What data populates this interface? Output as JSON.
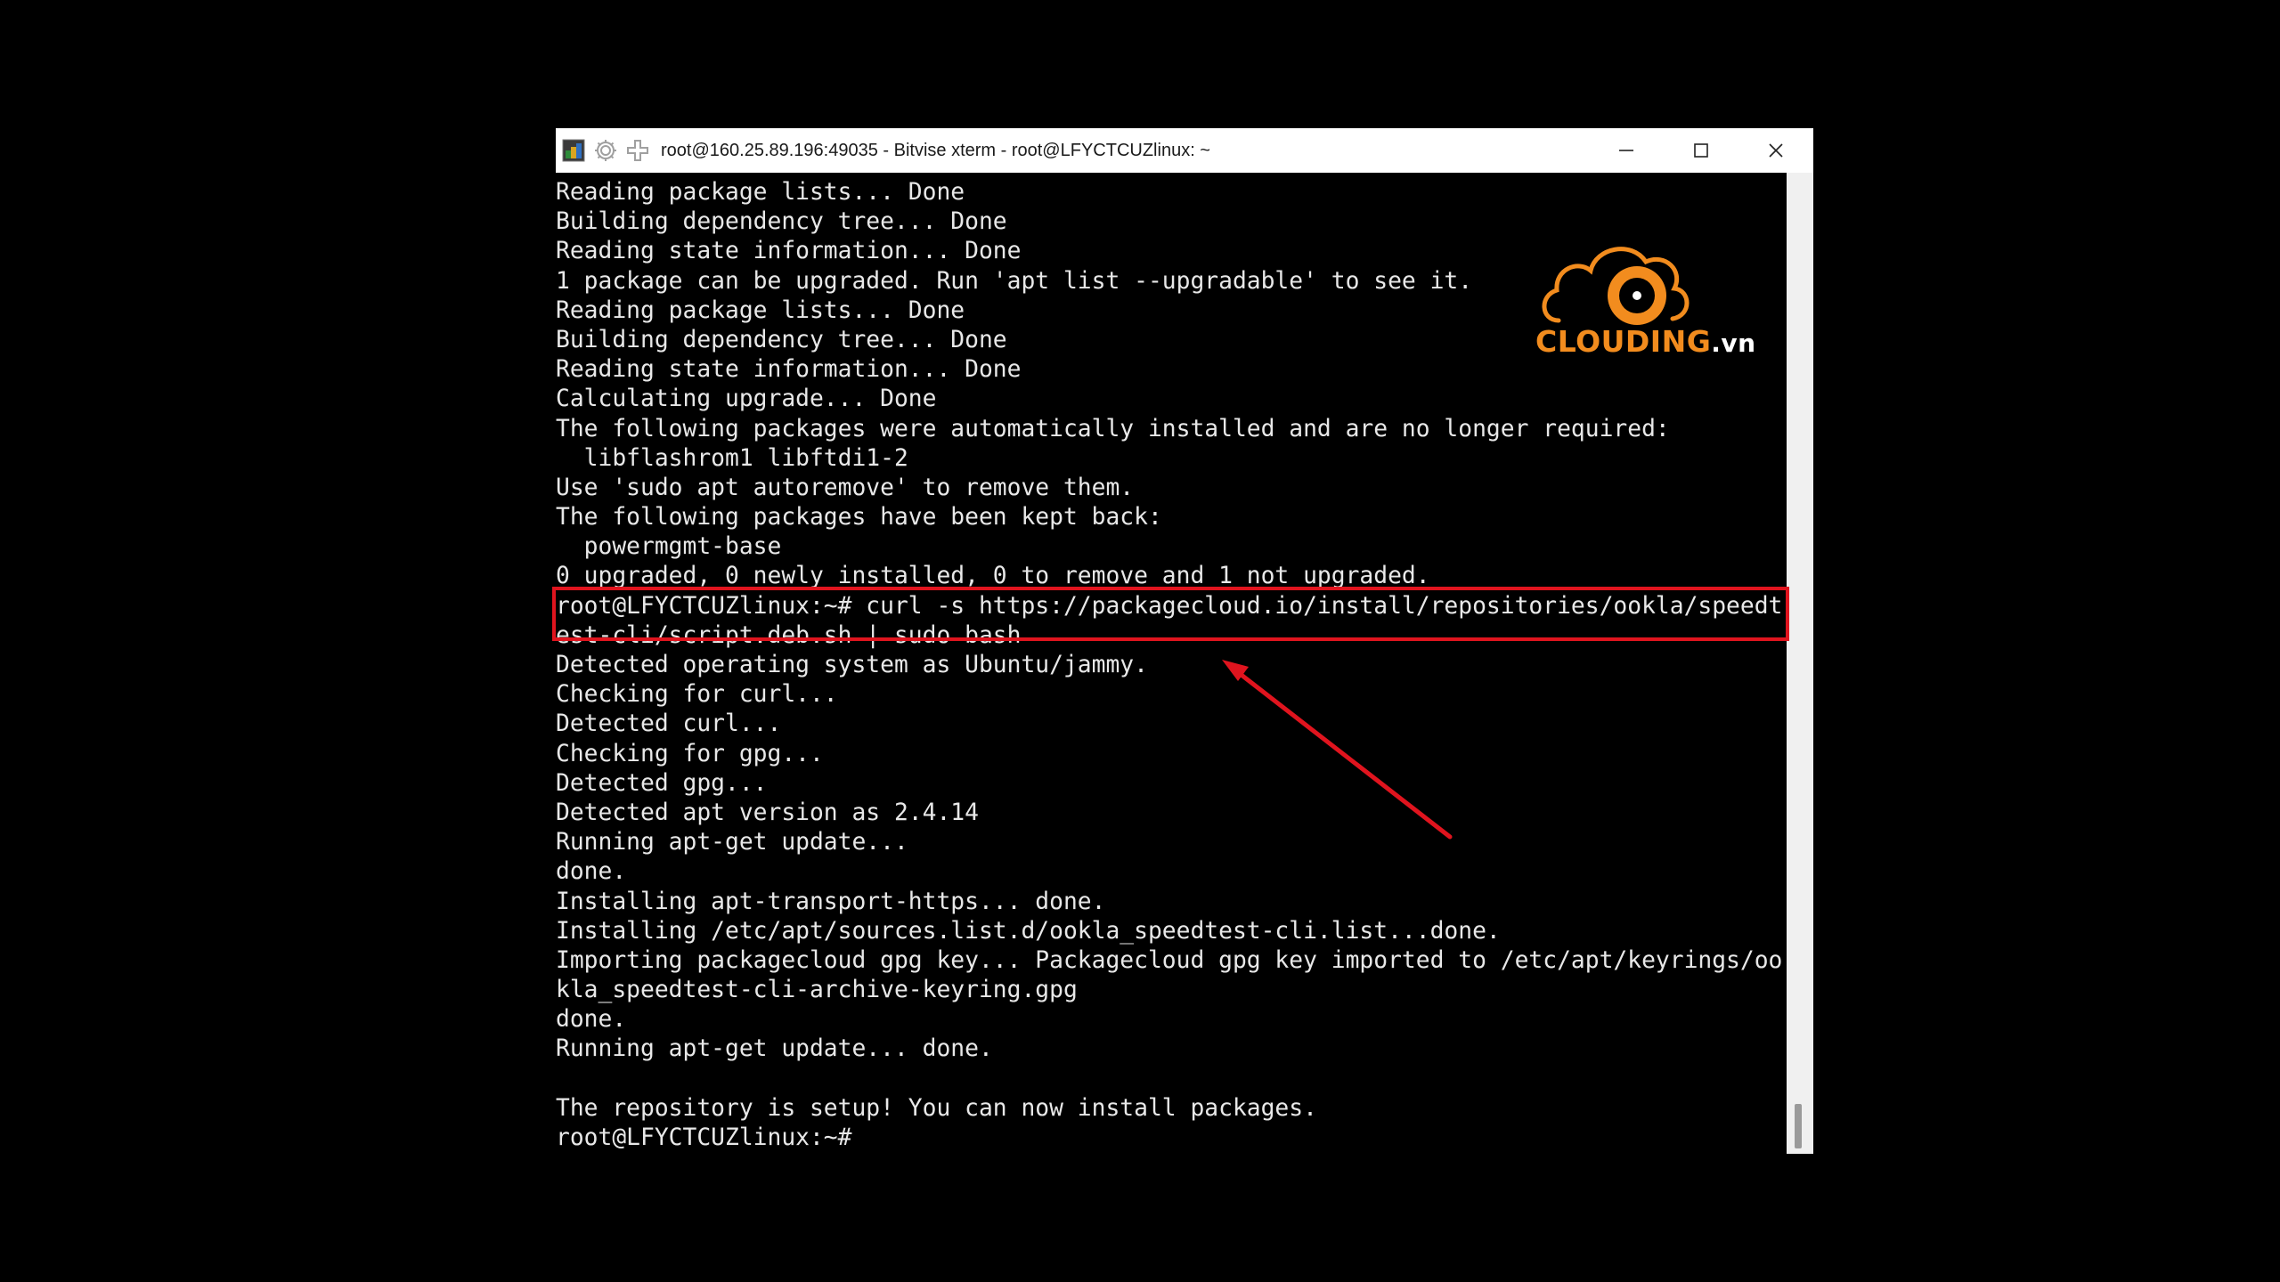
{
  "window": {
    "title": "root@160.25.89.196:49035 - Bitvise xterm - root@LFYCTCUZlinux: ~",
    "controls": [
      "minimize",
      "maximize",
      "close"
    ]
  },
  "icons": {
    "app": "bitvise-terminal-icon",
    "settings": "gear-icon",
    "new_window": "plus-icon"
  },
  "terminal": {
    "lines": [
      "Reading package lists... Done",
      "Building dependency tree... Done",
      "Reading state information... Done",
      "1 package can be upgraded. Run 'apt list --upgradable' to see it.",
      "Reading package lists... Done",
      "Building dependency tree... Done",
      "Reading state information... Done",
      "Calculating upgrade... Done",
      "The following packages were automatically installed and are no longer required:",
      "  libflashrom1 libftdi1-2",
      "Use 'sudo apt autoremove' to remove them.",
      "The following packages have been kept back:",
      "  powermgmt-base",
      "0 upgraded, 0 newly installed, 0 to remove and 1 not upgraded.",
      "root@LFYCTCUZlinux:~# curl -s https://packagecloud.io/install/repositories/ookla/speedt",
      "est-cli/script.deb.sh | sudo bash",
      "Detected operating system as Ubuntu/jammy.",
      "Checking for curl...",
      "Detected curl...",
      "Checking for gpg...",
      "Detected gpg...",
      "Detected apt version as 2.4.14",
      "Running apt-get update...",
      "done.",
      "Installing apt-transport-https... done.",
      "Installing /etc/apt/sources.list.d/ookla_speedtest-cli.list...done.",
      "Importing packagecloud gpg key... Packagecloud gpg key imported to /etc/apt/keyrings/oo",
      "kla_speedtest-cli-archive-keyring.gpg",
      "done.",
      "Running apt-get update... done.",
      "",
      "The repository is setup! You can now install packages.",
      "root@LFYCTCUZlinux:~#"
    ]
  },
  "logo": {
    "brand": "CLOUDING",
    "tld": ".vn",
    "brand_color": "#f28c1e"
  },
  "annotation": {
    "color": "#e0141e"
  },
  "colors": {
    "terminal_bg": "#000000",
    "terminal_fg": "#e8e8e8",
    "titlebar_bg": "#ffffff"
  }
}
